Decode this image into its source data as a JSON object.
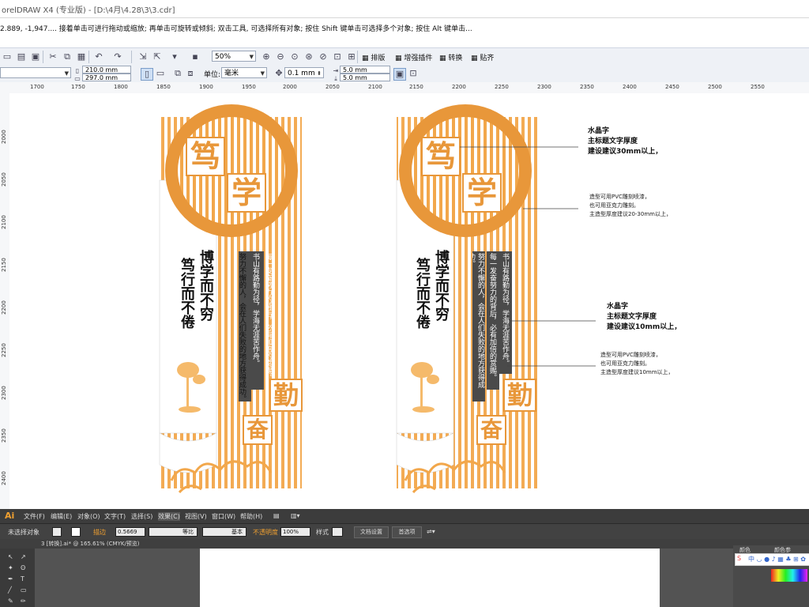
{
  "window": {
    "title": "orelDRAW X4 (专业版) - [D:\\4月\\4.28\\3\\3.cdr]"
  },
  "status": {
    "text": "2.889, -1,947.... 接着单击可进行拖动或缩放; 再单击可旋转或倾斜; 双击工具, 可选择所有对象; 按住 Shift 键单击可选择多个对象; 按住 Alt 键单击..."
  },
  "toolbar": {
    "zoom": "50%",
    "buttons": [
      "排版",
      "增强插件",
      "转换",
      "贴齐"
    ]
  },
  "propbar": {
    "width": "210.0 mm",
    "height": "297.0 mm",
    "unit_label": "单位:",
    "unit_value": "毫米",
    "nudge": "0.1 mm",
    "dup_x": "5.0 mm",
    "dup_y": "5.0 mm"
  },
  "ruler": {
    "h_ticks": [
      "1700",
      "1750",
      "1800",
      "1850",
      "1900",
      "1950",
      "2000",
      "2050",
      "2100",
      "2150",
      "2200",
      "2250",
      "2300",
      "2350",
      "2400",
      "2450",
      "2500",
      "2550"
    ],
    "v_ticks": [
      "2000",
      "2050",
      "2100",
      "2150",
      "2200",
      "2250",
      "2300",
      "2350",
      "2400"
    ]
  },
  "artwork": {
    "title_chars": [
      "笃",
      "学"
    ],
    "motto_col1": "博学而不穷",
    "motto_col2": "笃行而不倦",
    "poem_col1": "书山有路勤为径，学海无涯苦作舟。",
    "poem_col2": "每一发奋努力的背后，必有加倍的赏赐。",
    "poem_col3": "努力不懈的人，会在人们失败的地方获得成功。",
    "stamp_chars": [
      "勤",
      "奋"
    ],
    "colors": {
      "orange": "#E8973A",
      "orange_light": "#F4B35C",
      "dark": "#4a4a4a",
      "stripe": "#F2A74B"
    }
  },
  "annotations": [
    {
      "title": "水晶字",
      "line2": "主标题文字厚度",
      "line3": "建设建议30mm以上，"
    },
    {
      "line1": "造型可用PVC雕刻喷漆，",
      "line2": "也可用亚克力雕刻。",
      "line3": "主造型厚度建议20-30mm以上，"
    },
    {
      "title": "水晶字",
      "line2": "主标题文字厚度",
      "line3": "建设建议10mm以上，"
    },
    {
      "line1": "造型可用PVC雕刻喷漆，",
      "line2": "也可用亚克力雕刻。",
      "line3": "主造型厚度建议10mm以上，"
    }
  ],
  "illustrator": {
    "logo": "Ai",
    "menus": [
      "文件(F)",
      "编辑(E)",
      "对象(O)",
      "文字(T)",
      "选择(S)",
      "效果(C)",
      "视图(V)",
      "窗口(W)",
      "帮助(H)"
    ],
    "no_selection": "未选择对象",
    "stroke_label": "描边",
    "stroke_value": "0.5669",
    "profile1": "等比",
    "profile2": "基本",
    "opacity_label": "不透明度",
    "opacity_value": "100%",
    "style_label": "样式",
    "doc_setup": "文档设置",
    "prefs": "首选项",
    "doc_tab": "3 [转换].ai* @ 165.61% (CMYK/预览)",
    "panel_tab1": "颜色",
    "panel_tab2": "颜色参"
  }
}
